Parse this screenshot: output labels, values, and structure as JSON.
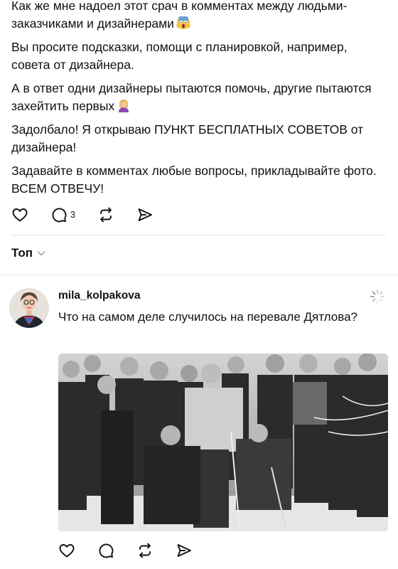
{
  "post": {
    "paragraphs": [
      "Как же мне надоел этот срач в комментах между людьми-заказчиками и дизайнерами",
      "Вы просите подсказки, помощи с планировкой, например, совета от дизайнера.",
      "А в ответ одни дизайнеры пытаются помочь, другие пытаются захейтить первых",
      "Задолбало! Я открываю ПУНКТ БЕСПЛАТНЫХ СОВЕТОВ от дизайнера!",
      "Задавайте в комментах любые вопросы, прикладывайте фото. ВСЕМ ОТВЕЧУ!"
    ],
    "emoji": [
      "screaming-face-emoji",
      "woman-facepalming-emoji"
    ],
    "actions": {
      "reply_count": "3"
    }
  },
  "comments_sort": {
    "label": "Топ"
  },
  "comment": {
    "username": "mila_kolpakova",
    "text": "Что на самом деле случилось на перевале Дятлова?",
    "photo": "black-and-white group photo of men in winter clothing"
  },
  "icons": [
    "heart-icon",
    "comment-icon",
    "repost-icon",
    "share-icon",
    "chevron-down-icon",
    "loading-icon"
  ],
  "colors": {
    "text": "#111111",
    "divider": "#e6e6e6",
    "muted": "#999999"
  }
}
